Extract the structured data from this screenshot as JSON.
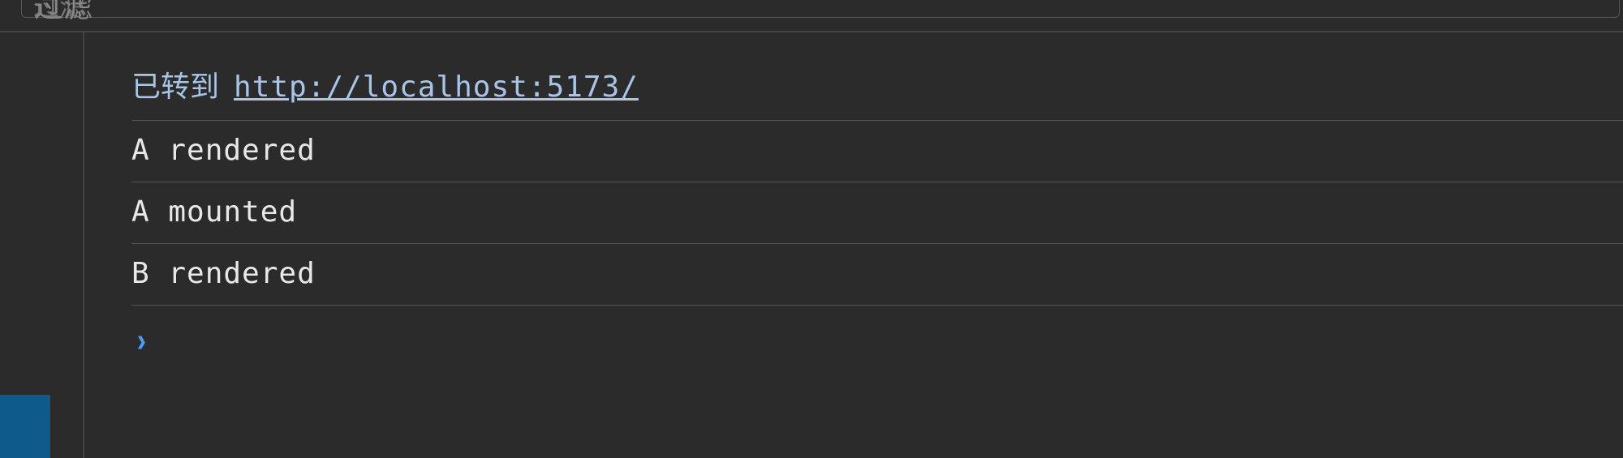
{
  "filter": {
    "placeholder": "过滤"
  },
  "console": {
    "navigation": {
      "prefix": "已转到",
      "url": "http://localhost:5173/"
    },
    "logs": [
      "A rendered",
      "A mounted",
      "B rendered"
    ],
    "prompt_symbol": "›"
  }
}
